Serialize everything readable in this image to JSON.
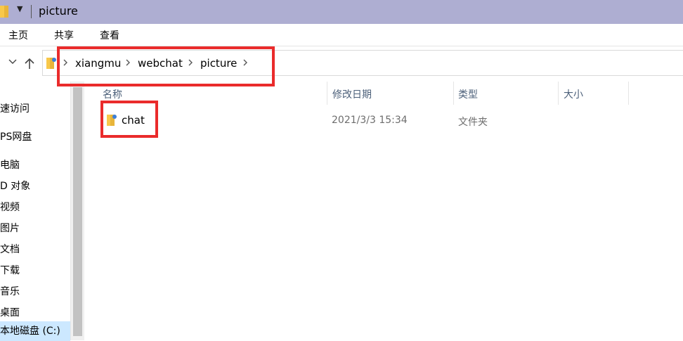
{
  "window": {
    "title": "picture"
  },
  "ribbon": {
    "tabs": [
      "主页",
      "共享",
      "查看"
    ]
  },
  "address": {
    "crumbs": [
      "xiangmu",
      "webchat",
      "picture"
    ]
  },
  "sidebar": {
    "items": [
      "速访问",
      "PS网盘",
      "电脑",
      "D 对象",
      "视频",
      "图片",
      "文档",
      "下载",
      "音乐",
      "桌面",
      "本地磁盘 (C:)"
    ],
    "active_index": 10
  },
  "columns": {
    "name": "名称",
    "date": "修改日期",
    "type": "类型",
    "size": "大小"
  },
  "files": [
    {
      "name": "chat",
      "date": "2021/3/3 15:34",
      "type": "文件夹",
      "size": ""
    }
  ],
  "colors": {
    "title_bar": "#aeaed2",
    "highlight_box": "#ea2b2b",
    "folder": "#f8c84a",
    "selected": "#cce8ff"
  },
  "icons": [
    "folder-icon",
    "chevron-down-icon",
    "up-arrow-icon",
    "chevron-right-icon"
  ]
}
